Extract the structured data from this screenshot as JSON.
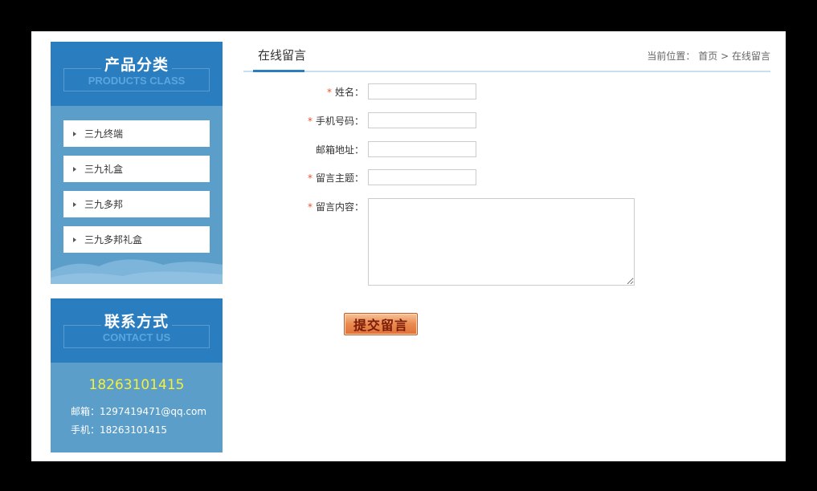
{
  "sidebar": {
    "products": {
      "title": "产品分类",
      "subtitle": "PRODUCTS CLASS",
      "items": [
        {
          "label": "三九终端"
        },
        {
          "label": "三九礼盒"
        },
        {
          "label": "三九多邦"
        },
        {
          "label": "三九多邦礼盒"
        }
      ]
    },
    "contact": {
      "title": "联系方式",
      "subtitle": "CONTACT US",
      "phone_big": "18263101415",
      "email_label": "邮箱：",
      "email": "1297419471@qq.com",
      "mobile_label": "手机：",
      "mobile": "18263101415"
    }
  },
  "main": {
    "tab": "在线留言",
    "breadcrumb": {
      "prefix": "当前位置：",
      "home": "首页",
      "separator": ">",
      "current": "在线留言"
    },
    "form": {
      "required_mark": "*",
      "fields": [
        {
          "label": "姓名：",
          "required": true,
          "value": ""
        },
        {
          "label": "手机号码：",
          "required": true,
          "value": ""
        },
        {
          "label": "邮箱地址：",
          "required": false,
          "value": ""
        },
        {
          "label": "留言主题：",
          "required": true,
          "value": ""
        },
        {
          "label": "留言内容：",
          "required": true,
          "value": ""
        }
      ],
      "submit_label": "提交留言"
    }
  },
  "colors": {
    "brand_blue": "#2a7dbf",
    "panel_blue": "#5b9ec9",
    "phone_yellow": "#f6f03a",
    "required_red": "#e5542b"
  }
}
